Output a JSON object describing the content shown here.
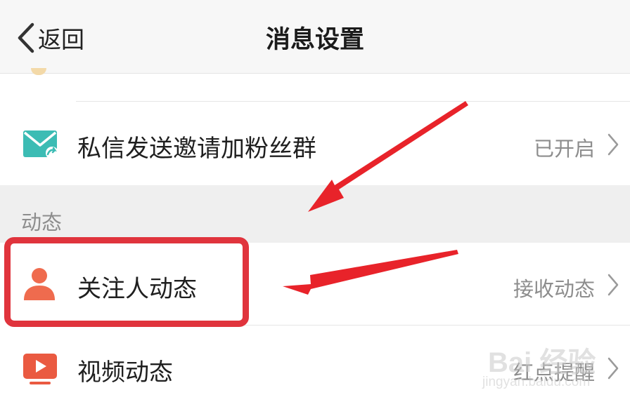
{
  "nav": {
    "back_label": "返回",
    "title": "消息设置"
  },
  "rows": [
    {
      "label": "私信发送邀请加粉丝群",
      "value": "已开启",
      "icon": "mail-icon"
    },
    {
      "label": "关注人动态",
      "value": "接收动态",
      "icon": "person-icon"
    },
    {
      "label": "视频动态",
      "value": "红点提醒",
      "icon": "video-icon"
    }
  ],
  "section": {
    "title": "动态"
  },
  "watermark": {
    "brand": "Bai 经验",
    "url": "jingyan.baidu.com"
  },
  "colors": {
    "accent_red": "#e0343d",
    "mail_teal": "#3cbcb4",
    "person_orange": "#ef6b4e",
    "video_red": "#ea5a41"
  }
}
